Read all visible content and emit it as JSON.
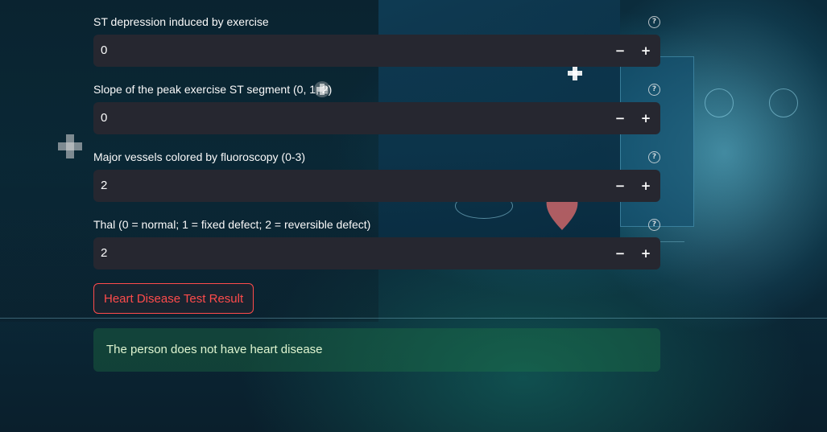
{
  "fields": [
    {
      "label": "ST depression induced by exercise",
      "value": "0",
      "minus": "−",
      "plus": "+",
      "help": "?"
    },
    {
      "label": "Slope of the peak exercise ST segment (0, 1, 2)",
      "value": "0",
      "minus": "−",
      "plus": "+",
      "help": "?"
    },
    {
      "label": "Major vessels colored by fluoroscopy (0-3)",
      "value": "2",
      "minus": "−",
      "plus": "+",
      "help": "?"
    },
    {
      "label": "Thal (0 = normal; 1 = fixed defect; 2 = reversible defect)",
      "value": "2",
      "minus": "−",
      "plus": "+",
      "help": "?"
    }
  ],
  "action_button": {
    "label": "Heart Disease Test Result"
  },
  "result": {
    "message": "The person does not have heart disease"
  },
  "colors": {
    "input_bg": "#262730",
    "text": "#fafafa",
    "button_accent": "#ff4b4b",
    "success_bg": "rgba(33,130,70,0.32)",
    "success_text": "#dff5d0"
  }
}
